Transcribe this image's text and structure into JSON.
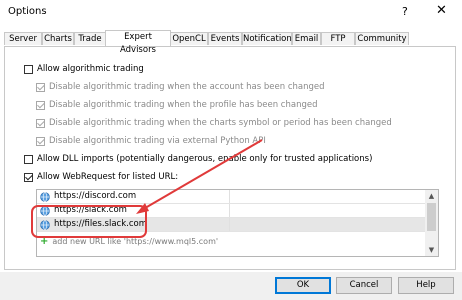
{
  "window": {
    "title": "Options",
    "help_label": "?",
    "close_label": "✕"
  },
  "tabs": [
    {
      "label": "Server"
    },
    {
      "label": "Charts"
    },
    {
      "label": "Trade"
    },
    {
      "label": "Expert Advisors",
      "active": true
    },
    {
      "label": "OpenCL"
    },
    {
      "label": "Events"
    },
    {
      "label": "Notifications"
    },
    {
      "label": "Email"
    },
    {
      "label": "FTP"
    },
    {
      "label": "Community"
    }
  ],
  "options": {
    "allow_algo": {
      "label": "Allow algorithmic trading",
      "checked": false
    },
    "disable_account": {
      "label": "Disable algorithmic trading when the account has been changed",
      "checked": true,
      "disabled": true
    },
    "disable_profile": {
      "label": "Disable algorithmic trading when the profile has been changed",
      "checked": true,
      "disabled": true
    },
    "disable_symbol": {
      "label": "Disable algorithmic trading when the charts symbol or period has been changed",
      "checked": true,
      "disabled": true
    },
    "disable_python": {
      "label": "Disable algorithmic trading via external Python API",
      "checked": true,
      "disabled": true
    },
    "allow_dll": {
      "label": "Allow DLL imports (potentially dangerous, enable only for trusted applications)",
      "checked": false
    },
    "allow_webrequest": {
      "label": "Allow WebRequest for listed URL:",
      "checked": true
    }
  },
  "url_list": {
    "urls": [
      "https://discord.com",
      "https://slack.com",
      "https://files.slack.com"
    ],
    "add_placeholder": "add new URL like 'https://www.mql5.com'"
  },
  "footer": {
    "ok": "OK",
    "cancel": "Cancel",
    "help": "Help"
  },
  "colors": {
    "annotation": "#e03a3a",
    "accent": "#0078d7"
  }
}
